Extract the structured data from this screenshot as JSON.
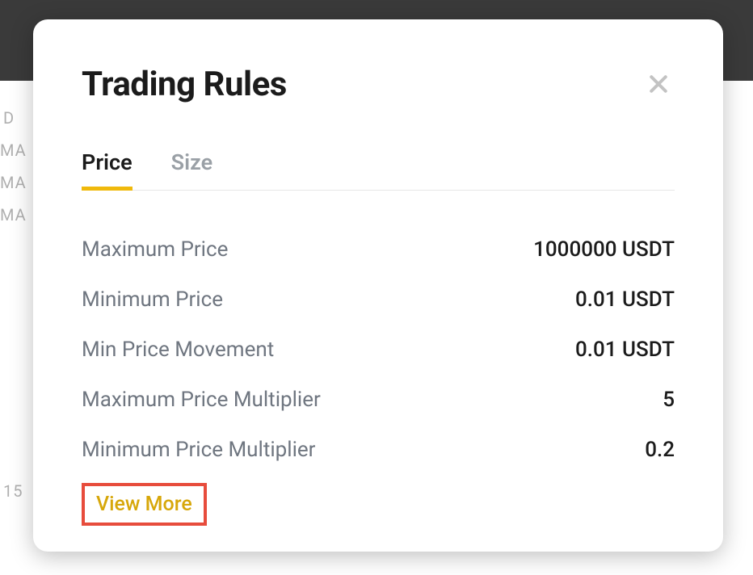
{
  "background": {
    "labels": [
      "D",
      "MA",
      "MA",
      "MA",
      "15"
    ]
  },
  "modal": {
    "title": "Trading Rules",
    "tabs": [
      {
        "label": "Price",
        "active": true
      },
      {
        "label": "Size",
        "active": false
      }
    ],
    "rules": [
      {
        "label": "Maximum Price",
        "value": "1000000 USDT"
      },
      {
        "label": "Minimum Price",
        "value": "0.01 USDT"
      },
      {
        "label": "Min Price Movement",
        "value": "0.01 USDT"
      },
      {
        "label": "Maximum Price Multiplier",
        "value": "5"
      },
      {
        "label": "Minimum Price Multiplier",
        "value": "0.2"
      }
    ],
    "view_more_label": "View More"
  },
  "colors": {
    "accent": "#f0b90b",
    "link": "#d7a70a",
    "highlight_border": "#e74c3c",
    "text_primary": "#1b1b1b",
    "text_secondary": "#6f7680",
    "text_muted": "#9aa0a6"
  }
}
